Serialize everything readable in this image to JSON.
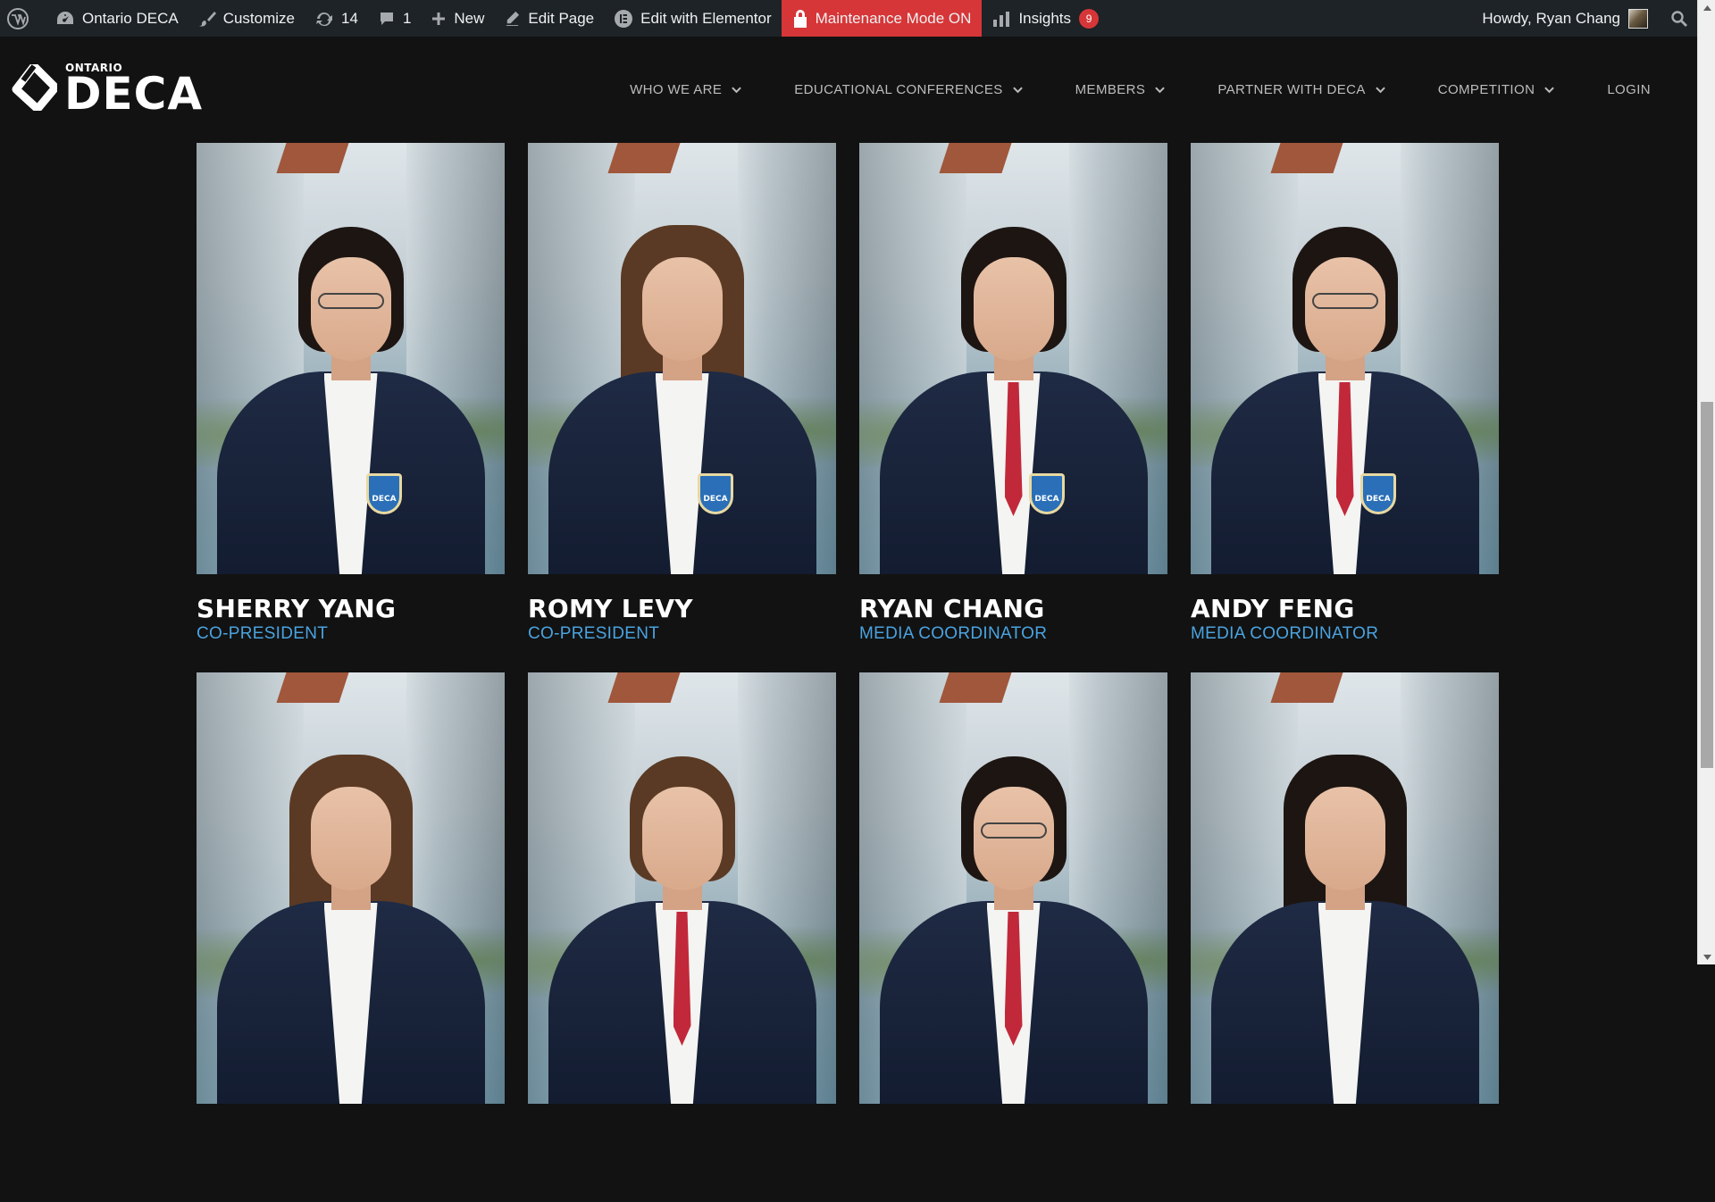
{
  "adminbar": {
    "site_name": "Ontario DECA",
    "customize": "Customize",
    "updates_count": "14",
    "comments_count": "1",
    "new_label": "New",
    "edit_page": "Edit Page",
    "edit_elementor": "Edit with Elementor",
    "maintenance": "Maintenance Mode ON",
    "insights": "Insights",
    "insights_badge": "9",
    "howdy": "Howdy, Ryan Chang"
  },
  "logo": {
    "small": "ONTARIO",
    "big": "DECA"
  },
  "nav": {
    "items": [
      {
        "label": "WHO WE ARE",
        "has_dropdown": true
      },
      {
        "label": "EDUCATIONAL CONFERENCES",
        "has_dropdown": true
      },
      {
        "label": "MEMBERS",
        "has_dropdown": true
      },
      {
        "label": "PARTNER WITH DECA",
        "has_dropdown": true
      },
      {
        "label": "COMPETITION",
        "has_dropdown": true
      },
      {
        "label": "LOGIN",
        "has_dropdown": false
      }
    ]
  },
  "team": {
    "members": [
      {
        "name": "SHERRY YANG",
        "role": "CO-PRESIDENT"
      },
      {
        "name": "ROMY LEVY",
        "role": "CO-PRESIDENT"
      },
      {
        "name": "RYAN CHANG",
        "role": "MEDIA COORDINATOR"
      },
      {
        "name": "ANDY FENG",
        "role": "MEDIA COORDINATOR"
      },
      {
        "name": "",
        "role": ""
      },
      {
        "name": "",
        "role": ""
      },
      {
        "name": "",
        "role": ""
      },
      {
        "name": "",
        "role": ""
      }
    ]
  },
  "colors": {
    "adminbar_bg": "#1d2327",
    "maintenance_red": "#d63638",
    "page_bg": "#121212",
    "role_blue": "#4aa3e0"
  }
}
